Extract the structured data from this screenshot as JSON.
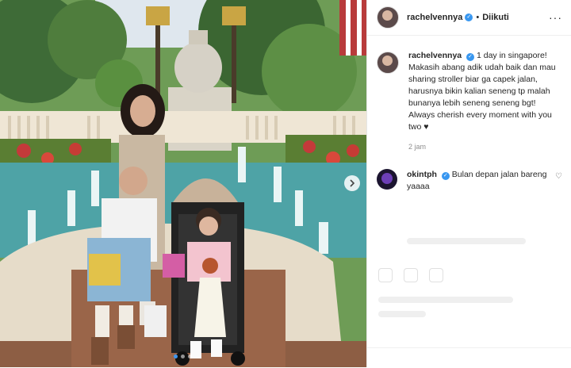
{
  "post": {
    "username": "rachelvennya",
    "follow_status": "Diikuti",
    "caption": "1 day in singapore! Makasih abang adik udah baik dan mau sharing stroller biar ga capek jalan, harusnya bikin kalian seneng tp malah bunanya lebih seneng seneng bgt! Always cherish every moment with you two ♥",
    "time": "2 jam",
    "more_icon": "more-horizontal-icon",
    "verified_icon": "verified-badge-icon"
  },
  "comments": [
    {
      "username": "okintph",
      "text": "Bulan depan jalan bareng yaaaa",
      "like_icon": "heart-icon"
    }
  ],
  "carousel": {
    "slides": 3,
    "active": 0,
    "next_icon": "chevron-right-icon"
  },
  "colors": {
    "verified": "#3897f0",
    "text": "#262626",
    "muted": "#8e8e8e"
  }
}
